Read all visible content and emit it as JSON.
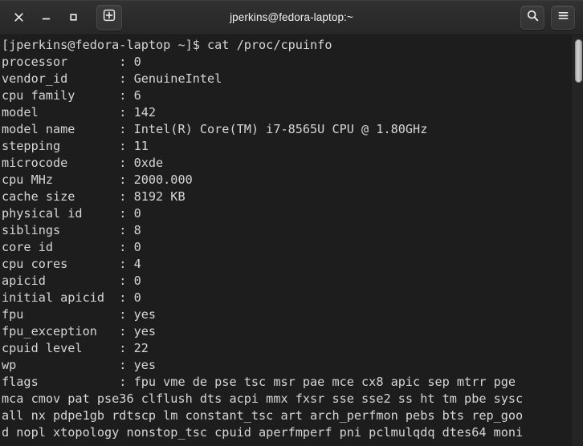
{
  "window": {
    "title": "jperkins@fedora-laptop:~",
    "controls": {
      "close_label": "×",
      "minimize_label": "–",
      "maximize_label": "□",
      "new_tab_label": "+"
    },
    "right_buttons": {
      "search_label": "Search",
      "menu_label": "Menu"
    }
  },
  "terminal": {
    "prompt": "[jperkins@fedora-laptop ~]$",
    "command": "cat /proc/cpuinfo",
    "prompt_line": "[jperkins@fedora-laptop ~]$ cat /proc/cpuinfo",
    "fields": [
      {
        "key": "processor",
        "value": "0"
      },
      {
        "key": "vendor_id",
        "value": "GenuineIntel"
      },
      {
        "key": "cpu family",
        "value": "6"
      },
      {
        "key": "model",
        "value": "142"
      },
      {
        "key": "model name",
        "value": "Intel(R) Core(TM) i7-8565U CPU @ 1.80GHz"
      },
      {
        "key": "stepping",
        "value": "11"
      },
      {
        "key": "microcode",
        "value": "0xde"
      },
      {
        "key": "cpu MHz",
        "value": "2000.000"
      },
      {
        "key": "cache size",
        "value": "8192 KB"
      },
      {
        "key": "physical id",
        "value": "0"
      },
      {
        "key": "siblings",
        "value": "8"
      },
      {
        "key": "core id",
        "value": "0"
      },
      {
        "key": "cpu cores",
        "value": "4"
      },
      {
        "key": "apicid",
        "value": "0"
      },
      {
        "key": "initial apicid",
        "value": "0"
      },
      {
        "key": "fpu",
        "value": "yes"
      },
      {
        "key": "fpu_exception",
        "value": "yes"
      },
      {
        "key": "cpuid level",
        "value": "22"
      },
      {
        "key": "wp",
        "value": "yes"
      },
      {
        "key": "flags",
        "value": "fpu vme de pse tsc msr pae mce cx8 apic sep mtrr pge mca cmov pat pse36 clflush dts acpi mmx fxsr sse sse2 ss ht tm pbe syscall nx pdpe1gb rdtscp lm constant_tsc art arch_perfmon pebs bts rep_good nopl xtopology nonstop_tsc cpuid aperfmperf pni pclmulqdq dtes64 moni"
      }
    ],
    "rendered_lines": [
      "[jperkins@fedora-laptop ~]$ cat /proc/cpuinfo",
      "processor       : 0",
      "vendor_id       : GenuineIntel",
      "cpu family      : 6",
      "model           : 142",
      "model name      : Intel(R) Core(TM) i7-8565U CPU @ 1.80GHz",
      "stepping        : 11",
      "microcode       : 0xde",
      "cpu MHz         : 2000.000",
      "cache size      : 8192 KB",
      "physical id     : 0",
      "siblings        : 8",
      "core id         : 0",
      "cpu cores       : 4",
      "apicid          : 0",
      "initial apicid  : 0",
      "fpu             : yes",
      "fpu_exception   : yes",
      "cpuid level     : 22",
      "wp              : yes",
      "flags           : fpu vme de pse tsc msr pae mce cx8 apic sep mtrr pge",
      "mca cmov pat pse36 clflush dts acpi mmx fxsr sse sse2 ss ht tm pbe sysc",
      "all nx pdpe1gb rdtscp lm constant_tsc art arch_perfmon pebs bts rep_goo",
      "d nopl xtopology nonstop_tsc cpuid aperfmperf pni pclmulqdq dtes64 moni"
    ],
    "colors": {
      "background": "#1d1d1d",
      "foreground": "#d6d6d6",
      "titlebar": "#2f2f2f",
      "scrollbar_thumb": "#c4c4c4"
    }
  }
}
